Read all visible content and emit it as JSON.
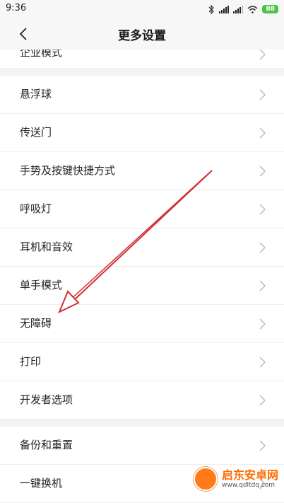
{
  "status": {
    "time": "9:36",
    "battery": "88",
    "icons": [
      "bluetooth-icon",
      "signal-icon",
      "signal-icon",
      "wifi-icon",
      "battery-icon"
    ]
  },
  "header": {
    "title": "更多设置"
  },
  "list": {
    "partial_label": "企业模式",
    "group1": [
      "悬浮球",
      "传送门",
      "手势及按键快捷方式",
      "呼吸灯",
      "耳机和音效",
      "单手模式",
      "无障碍",
      "打印",
      "开发者选项"
    ],
    "group2": [
      "备份和重置",
      "一键换机"
    ]
  },
  "watermark": {
    "title": "启东安卓网",
    "url": "www.qdltdq.com"
  },
  "colors": {
    "arrow": "#d32f2f",
    "battery": "#4ec24a",
    "accent": "#ff6a00"
  }
}
